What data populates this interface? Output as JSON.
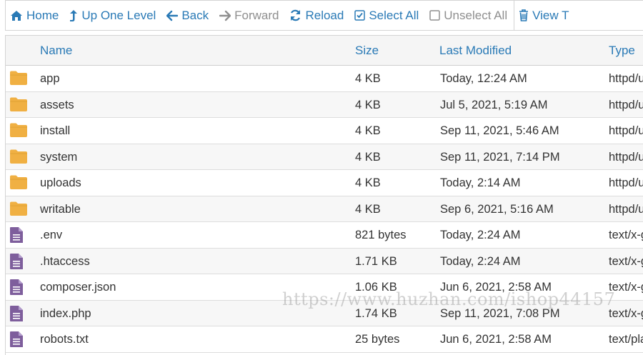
{
  "toolbar": {
    "home": "Home",
    "up_one_level": "Up One Level",
    "back": "Back",
    "forward": "Forward",
    "reload": "Reload",
    "select_all": "Select All",
    "unselect_all": "Unselect All",
    "view_trash": "View T"
  },
  "table": {
    "headers": {
      "name": "Name",
      "size": "Size",
      "modified": "Last Modified",
      "type": "Type"
    },
    "rows": [
      {
        "icon": "folder-icon",
        "name": "app",
        "size": "4 KB",
        "modified": "Today, 12:24 AM",
        "type": "httpd/u"
      },
      {
        "icon": "folder-icon",
        "name": "assets",
        "size": "4 KB",
        "modified": "Jul 5, 2021, 5:19 AM",
        "type": "httpd/u"
      },
      {
        "icon": "folder-icon",
        "name": "install",
        "size": "4 KB",
        "modified": "Sep 11, 2021, 5:46 AM",
        "type": "httpd/u"
      },
      {
        "icon": "folder-icon",
        "name": "system",
        "size": "4 KB",
        "modified": "Sep 11, 2021, 7:14 PM",
        "type": "httpd/u"
      },
      {
        "icon": "folder-icon",
        "name": "uploads",
        "size": "4 KB",
        "modified": "Today, 2:14 AM",
        "type": "httpd/u"
      },
      {
        "icon": "folder-icon",
        "name": "writable",
        "size": "4 KB",
        "modified": "Sep 6, 2021, 5:16 AM",
        "type": "httpd/u"
      },
      {
        "icon": "file-icon",
        "name": ".env",
        "size": "821 bytes",
        "modified": "Today, 2:24 AM",
        "type": "text/x-g"
      },
      {
        "icon": "file-icon",
        "name": ".htaccess",
        "size": "1.71 KB",
        "modified": "Today, 2:24 AM",
        "type": "text/x-g"
      },
      {
        "icon": "file-icon",
        "name": "composer.json",
        "size": "1.06 KB",
        "modified": "Jun 6, 2021, 2:58 AM",
        "type": "text/x-g"
      },
      {
        "icon": "file-icon",
        "name": "index.php",
        "size": "1.74 KB",
        "modified": "Sep 11, 2021, 7:08 PM",
        "type": "text/x-g"
      },
      {
        "icon": "file-icon",
        "name": "robots.txt",
        "size": "25 bytes",
        "modified": "Jun 6, 2021, 2:58 AM",
        "type": "text/pla"
      }
    ]
  },
  "watermark": "https://www.huzhan.com/ishop44157",
  "colors": {
    "link": "#2a7ab6",
    "disabled": "#8f8f8f",
    "folder": "#f0b043",
    "file": "#7e5e9c",
    "header_bg": "#f5f5f5",
    "row_alt": "#f7f7f7"
  }
}
